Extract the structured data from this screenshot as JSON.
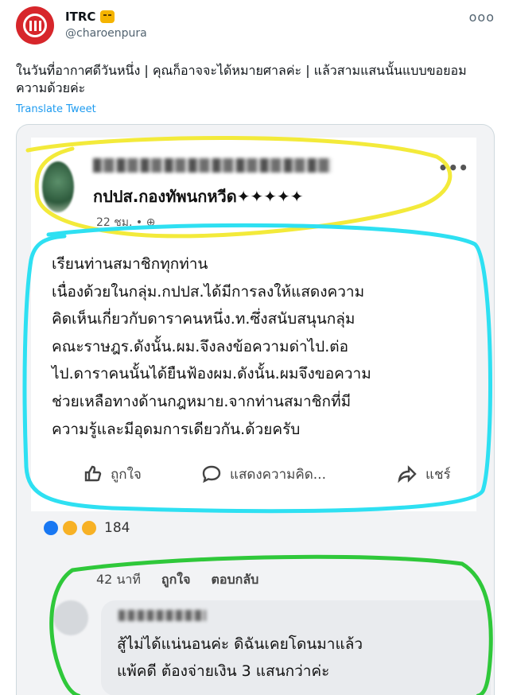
{
  "tweet": {
    "display_name": "ITRC",
    "handle": "@charoenpura",
    "more_label": "ooo",
    "text": "ในวันที่อากาศดีวันหนึ่ง | คุณก็อาจจะได้หมายศาลค่ะ | แล้วสามแสนนั้นแบบขอยอมความด้วยค่ะ",
    "translate_label": "Translate Tweet"
  },
  "fb_post": {
    "group_name": "กปปส.กองทัพนกหวีด✦✦✦✦✦",
    "time": "22 ชม. • ⊕",
    "more_label": "•••",
    "body_lines": [
      "เรียนท่านสมาชิกทุกท่าน",
      "เนื่องด้วยในกลุ่ม.กปปส.ได้มีการลงให้แสดงความ",
      "คิดเห็นเกี่ยวกับดาราคนหนึ่ง.ท.ซึ่งสนับสนุนกลุ่ม",
      "คณะราษฎร.ดังนั้น.ผม.จึงลงข้อความด่าไป.ต่อ",
      "ไป.ดาราคนนั้นได้ยืนฟ้องผม.ดังนั้น.ผมจึงขอความ",
      "ช่วยเหลือทางด้านกฎหมาย.จากท่านสมาชิกที่มี",
      "ความรู้และมีอุดมการเดียวกัน.ด้วยครับ"
    ],
    "actions": {
      "like": "ถูกใจ",
      "comment": "แสดงความคิด...",
      "share": "แชร์"
    },
    "reaction_count": "184"
  },
  "comment": {
    "time": "42 นาที",
    "like_label": "ถูกใจ",
    "reply_label": "ตอบกลับ",
    "lines": [
      "สู้ไม่ได้แน่นอนค่ะ ดิฉันเคยโดนมาแล้ว",
      "แพ้คดี ต้องจ่ายเงิน 3 แสนกว่าค่ะ"
    ]
  },
  "colors": {
    "avatar": "#d7262b",
    "link": "#1d9bf0",
    "marker_yellow": "#f3ea3a",
    "marker_cyan": "#2ee0f2",
    "marker_green": "#2fc83a",
    "fb_like": "#1877f2"
  }
}
